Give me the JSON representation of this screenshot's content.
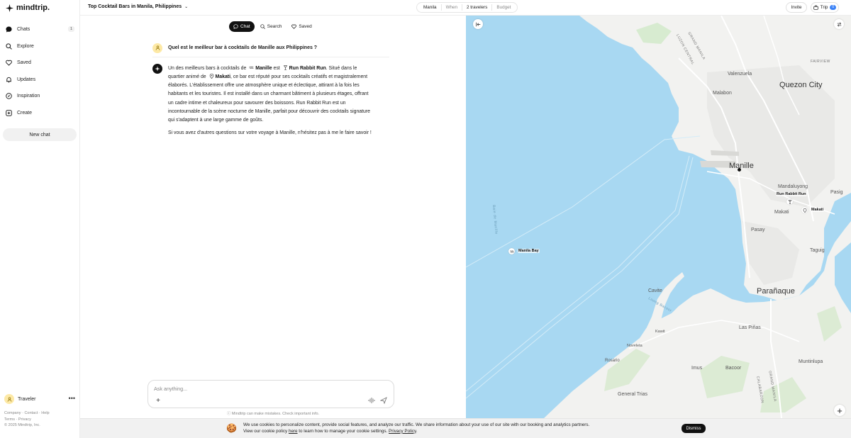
{
  "app": {
    "logo": "mindtrip."
  },
  "sidebar": {
    "items": [
      {
        "label": "Chats",
        "badge": "1",
        "icon": "chat-bubble-icon"
      },
      {
        "label": "Explore",
        "icon": "search-icon"
      },
      {
        "label": "Saved",
        "icon": "heart-icon"
      },
      {
        "label": "Updates",
        "icon": "bell-icon"
      },
      {
        "label": "Inspiration",
        "icon": "compass-icon"
      },
      {
        "label": "Create",
        "icon": "plus-square-icon"
      }
    ],
    "new_chat": "New chat",
    "user_name": "Traveler",
    "footer": {
      "company": "Company",
      "contact": "Contact",
      "help": "Help",
      "terms": "Terms",
      "privacy": "Privacy",
      "copyright": "© 2025 Mindtrip, Inc."
    }
  },
  "header": {
    "title": "Top Cocktail Bars in Manila, Philippines",
    "filters": {
      "location": "Manila",
      "when": "When",
      "travelers": "2 travelers",
      "budget": "Budget"
    },
    "invite": "Invite",
    "trip": "Trip",
    "trip_count": "0"
  },
  "chat": {
    "tabs": {
      "chat": "Chat",
      "search": "Search",
      "saved": "Saved"
    },
    "question": "Quel est le meilleur bar à cocktails de Manille aux Philippines ?",
    "answer": {
      "p1_a": "Un des meilleurs bars à cocktails de",
      "p1_city": "Manille",
      "p1_b": "est",
      "p1_bar": "Run Rabbit Run",
      "p1_c": ". Situé dans le quartier animé de",
      "p1_district": "Makati",
      "p1_d": ", ce bar est réputé pour ses cocktails créatifs et magistralement élaborés. L'établissement offre une atmosphère unique et éclectique, attirant à la fois les habitants et les touristes. Il est installé dans un charmant bâtiment à plusieurs étages, offrant un cadre intime et chaleureux pour savourer des boissons. Run Rabbit Run est un incontournable de la scène nocturne de Manille, parfait pour découvrir des cocktails signature qui s'adaptent à une large gamme de goûts.",
      "p2": "Si vous avez d'autres questions sur votre voyage à Manille, n'hésitez pas à me le faire savoir !"
    },
    "composer_placeholder": "Ask anything...",
    "disclaimer": "Mindtrip can make mistakes. Check important info."
  },
  "map": {
    "labels": {
      "quezon": "Quezon City",
      "valenzuela": "Valenzuela",
      "malabon": "Malabon",
      "fairview": "FAIRVIEW",
      "manille": "Manille",
      "mandaluyong": "Mandaluyong",
      "pasig": "Pasig",
      "makati_area": "Makati",
      "pasay": "Pasay",
      "taguig": "Taguig",
      "paranaque": "Parañaque",
      "cavite": "Cavite",
      "laspinas": "Las Piñas",
      "kawit": "Kawit",
      "noveleta": "Noveleta",
      "rosario": "Rosario",
      "imus": "Imus",
      "bacoor": "Bacoor",
      "muntinlupa": "Muntinlupa",
      "generaltrias": "General Trias",
      "grandmanila": "GRAND MANILA",
      "luzoncentral": "LUZON CENTRAL",
      "calabarzon": "CALABARZON",
      "grandmanila2": "GRAND MANILA",
      "baie": "Baie de Manille",
      "baie2": "Loong Bacoor"
    },
    "pins": {
      "manilabay": "Manila Bay",
      "runrabbit": "Run Rabbit Run",
      "makati": "Makati"
    }
  },
  "cookie": {
    "line1": "We use cookies to personalize content, provide social features, and analyze our traffic. We share information about your use of our site with our booking and analytics partners.",
    "line2_a": "View our cookie policy",
    "here": "here",
    "line2_b": "to learn how to manage your cookie settings.",
    "privacy": "Privacy Policy",
    "dismiss": "Dismiss"
  }
}
